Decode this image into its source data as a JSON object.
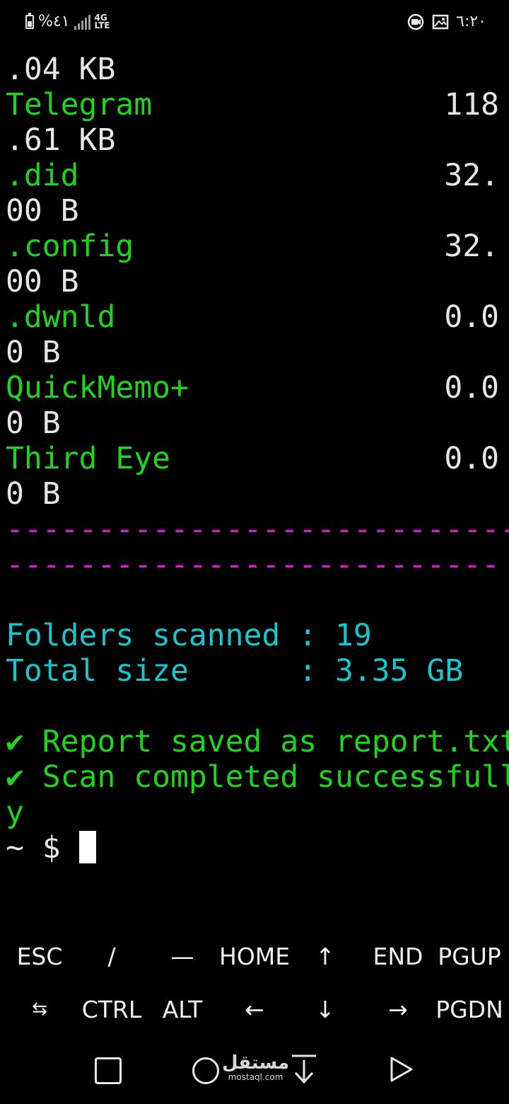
{
  "status_bar": {
    "battery_icon": "battery-icon",
    "battery_text": "%٤١",
    "signal_icon": "signal-bars-icon",
    "network_icon": "4g-lte-icon",
    "network_top": "4G",
    "network_bottom": "LTE",
    "notification_icon_1": "screen-recorder-icon",
    "notification_icon_2": "image-icon",
    "time": "٦:٢٠"
  },
  "terminal": {
    "lines": [
      {
        "left": ".04 KB",
        "left_color": "white",
        "right": ""
      },
      {
        "left": "Telegram",
        "left_color": "green",
        "right": "118"
      },
      {
        "left": ".61 KB",
        "left_color": "white",
        "right": ""
      },
      {
        "left": ".did",
        "left_color": "green",
        "right": "32."
      },
      {
        "left": "00 B",
        "left_color": "white",
        "right": ""
      },
      {
        "left": ".config",
        "left_color": "green",
        "right": "32."
      },
      {
        "left": "00 B",
        "left_color": "white",
        "right": ""
      },
      {
        "left": ".dwnld",
        "left_color": "green",
        "right": "0.0"
      },
      {
        "left": "0 B",
        "left_color": "white",
        "right": ""
      },
      {
        "left": "QuickMemo+",
        "left_color": "green",
        "right": "0.0"
      },
      {
        "left": "0 B",
        "left_color": "white",
        "right": ""
      },
      {
        "left": "Third Eye",
        "left_color": "green",
        "right": "0.0"
      },
      {
        "left": "0 B",
        "left_color": "white",
        "right": ""
      },
      {
        "left": "----------------------------",
        "left_color": "magenta",
        "right": ""
      },
      {
        "left": "---------------------------",
        "left_color": "magenta",
        "right": ""
      },
      {
        "left": "",
        "left_color": "white",
        "right": ""
      },
      {
        "left": "Folders scanned : 19",
        "left_color": "cyan",
        "right": ""
      },
      {
        "left": "Total size      : 3.35 GB",
        "left_color": "cyan",
        "right": ""
      },
      {
        "left": "",
        "left_color": "white",
        "right": ""
      },
      {
        "left": "✔ Report saved as report.txt",
        "left_color": "green",
        "right": ""
      },
      {
        "left": "✔ Scan completed successfull",
        "left_color": "green",
        "right": ""
      },
      {
        "left": "y",
        "left_color": "green",
        "right": ""
      }
    ],
    "prompt": "~ $ "
  },
  "extra_keys": {
    "row1": [
      "ESC",
      "/",
      "—",
      "HOME",
      "↑",
      "END",
      "PGUP"
    ],
    "row2": [
      "⇆",
      "CTRL",
      "ALT",
      "←",
      "↓",
      "→",
      "PGDN"
    ]
  },
  "nav_bar": {
    "recent_icon": "square-recents-icon",
    "home_icon": "circle-home-icon",
    "notification_icon": "swipe-down-icon",
    "back_icon": "triangle-back-icon"
  },
  "watermark": {
    "arabic": "مستقل",
    "latin": "mostaql.com"
  },
  "colors": {
    "background": "#000000",
    "green": "#1fd41f",
    "cyan": "#17c6cf",
    "magenta": "#d61ad6",
    "white": "#e6e6e6"
  }
}
